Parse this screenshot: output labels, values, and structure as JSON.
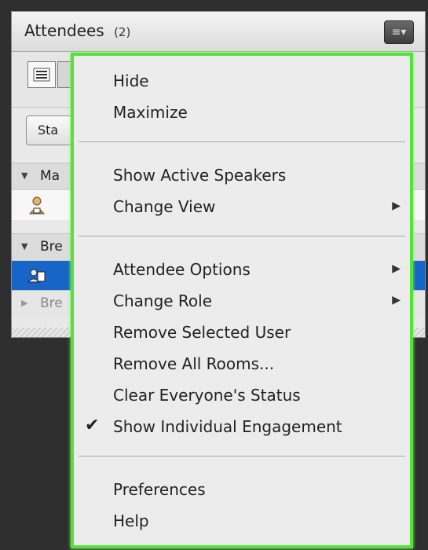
{
  "pod": {
    "title": "Attendees",
    "count": "(2)",
    "menu_icon": "list-menu-icon",
    "status_button_label": "Sta",
    "sections": [
      {
        "label": "Ma"
      },
      {
        "label": "Bre"
      },
      {
        "label": "Bre"
      }
    ],
    "selected_row_color": "#1765c6"
  },
  "menu": {
    "groups": [
      [
        {
          "label": "Hide"
        },
        {
          "label": "Maximize"
        }
      ],
      [
        {
          "label": "Show Active Speakers"
        },
        {
          "label": "Change View",
          "submenu": true
        }
      ],
      [
        {
          "label": "Attendee Options",
          "submenu": true
        },
        {
          "label": "Change Role",
          "submenu": true
        },
        {
          "label": "Remove Selected User"
        },
        {
          "label": "Remove All Rooms..."
        },
        {
          "label": "Clear Everyone's Status"
        },
        {
          "label": "Show Individual Engagement",
          "checked": true
        }
      ],
      [
        {
          "label": "Preferences"
        },
        {
          "label": "Help"
        }
      ]
    ],
    "highlight_color": "#55e03a"
  }
}
